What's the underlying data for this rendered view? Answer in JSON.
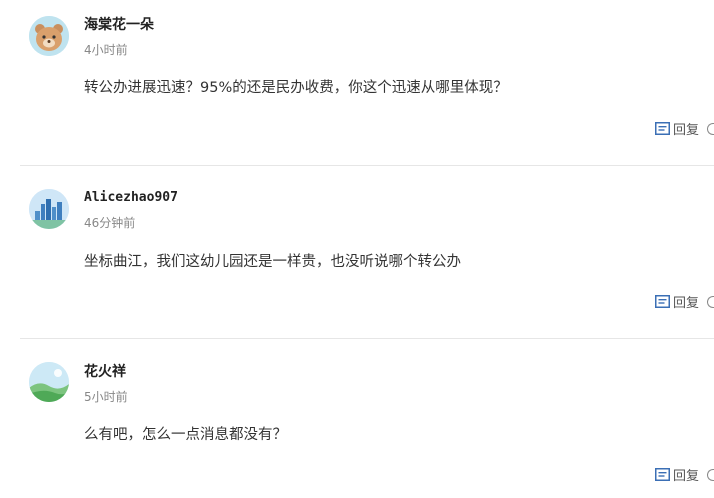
{
  "comments": [
    {
      "username": "海棠花一朵",
      "time": "4小时前",
      "content": "转公办进展迅速？95%的还是民办收费，你这个迅速从哪里体现？",
      "reply_label": "回复",
      "avatar_icon": "bear-avatar-icon"
    },
    {
      "username": "Alicezhao907",
      "time": "46分钟前",
      "content": "坐标曲江，我们这幼儿园还是一样贵，也没听说哪个转公办",
      "reply_label": "回复",
      "avatar_icon": "city-skyline-avatar-icon"
    },
    {
      "username": "花火祥",
      "time": "5小时前",
      "content": "么有吧，怎么一点消息都没有？",
      "reply_label": "回复",
      "avatar_icon": "landscape-avatar-icon"
    }
  ],
  "colors": {
    "text": "#333333",
    "meta": "#888888",
    "divider": "#e6e6e6",
    "reply_icon": "#3b6fb5"
  }
}
